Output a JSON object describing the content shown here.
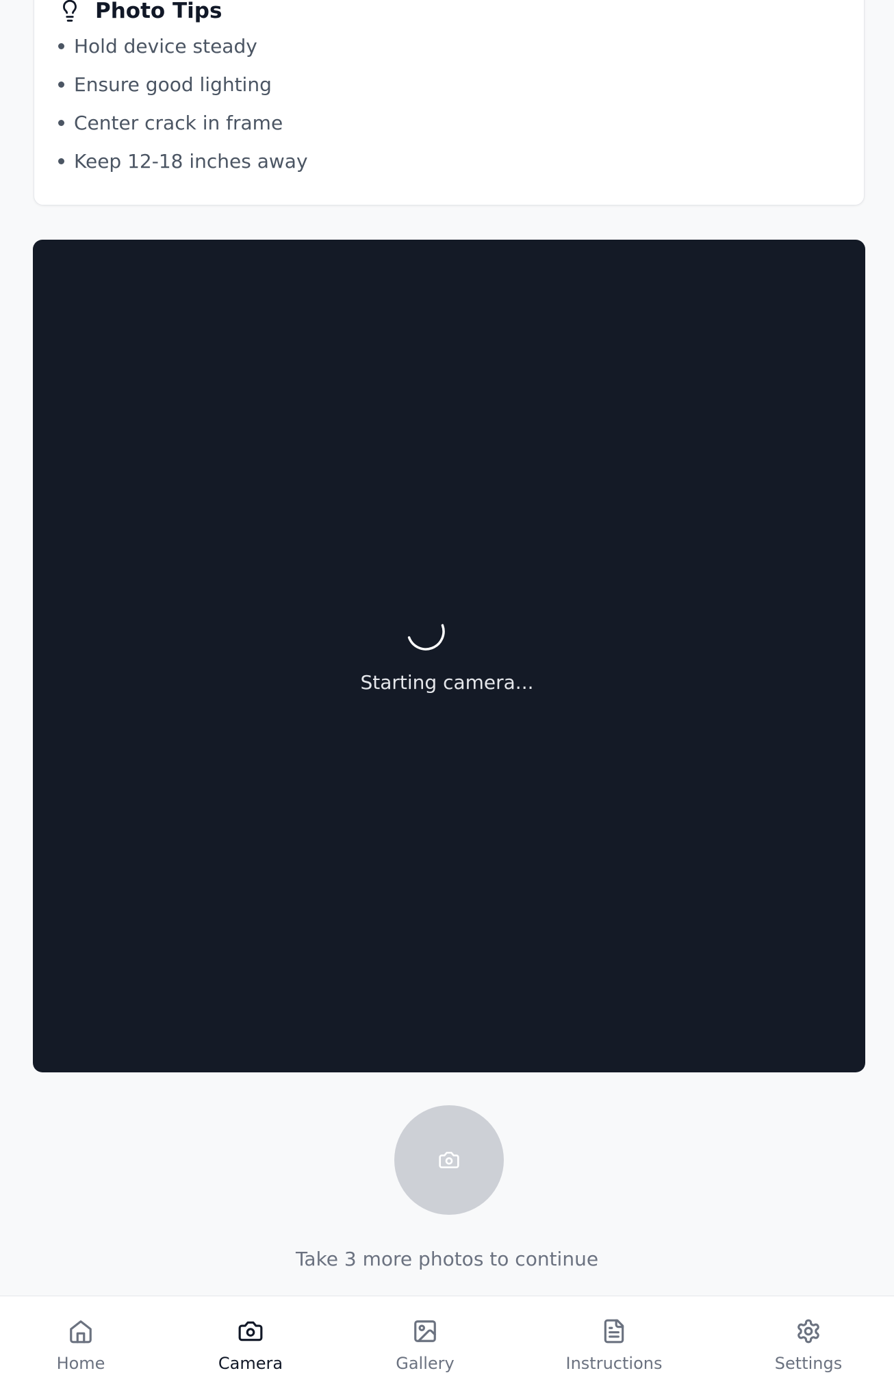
{
  "tips": {
    "title": "Photo Tips",
    "icon": "lightbulb-icon",
    "items": [
      "Hold device steady",
      "Ensure good lighting",
      "Center crack in frame",
      "Keep 12-18 inches away"
    ]
  },
  "camera": {
    "status": "Starting camera...",
    "capture_icon": "camera-icon"
  },
  "hint": "Take 3 more photos to continue",
  "nav": {
    "active": "Camera",
    "items": [
      {
        "label": "Home",
        "icon": "home-icon"
      },
      {
        "label": "Camera",
        "icon": "camera-icon"
      },
      {
        "label": "Gallery",
        "icon": "image-icon"
      },
      {
        "label": "Instructions",
        "icon": "document-icon"
      },
      {
        "label": "Settings",
        "icon": "gear-icon"
      }
    ]
  },
  "colors": {
    "viewport_bg": "#141a26",
    "capture_button": "#cdd0d6",
    "active_nav": "#111827",
    "inactive_nav": "#6b7280"
  }
}
